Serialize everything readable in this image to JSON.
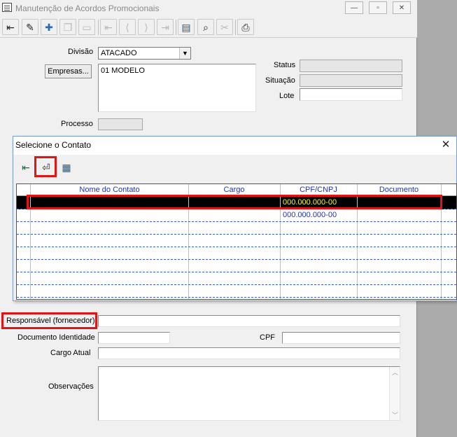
{
  "main_window": {
    "title": "Manutenção de Acordos Promocionais",
    "caption_buttons": [
      "—",
      "▫",
      "✕"
    ]
  },
  "toolbar": {
    "buttons": [
      {
        "name": "exit-icon",
        "glyph": "⇤"
      },
      {
        "name": "pencil-icon",
        "glyph": "✎"
      },
      {
        "name": "add-record-icon",
        "glyph": "✚"
      },
      {
        "name": "copy-record-icon",
        "glyph": "❐"
      },
      {
        "name": "remove-record-icon",
        "glyph": "▭"
      },
      {
        "name": "first-record-icon",
        "glyph": "⇤"
      },
      {
        "name": "prev-record-icon",
        "glyph": "⟨"
      },
      {
        "name": "next-record-icon",
        "glyph": "⟩"
      },
      {
        "name": "last-record-icon",
        "glyph": "⇥"
      },
      {
        "name": "list-icon",
        "glyph": "▤"
      },
      {
        "name": "binoculars-icon",
        "glyph": "⌕"
      },
      {
        "name": "tools-icon",
        "glyph": "✂"
      },
      {
        "name": "printer-icon",
        "glyph": "⎙"
      }
    ]
  },
  "form": {
    "divisao_label": "Divisão",
    "divisao_value": "ATACADO",
    "empresas_button": "Empresas...",
    "empresas_value": "01 MODELO",
    "status_label": "Status",
    "status_value": "",
    "situacao_label": "Situação",
    "situacao_value": "",
    "lote_label": "Lote",
    "lote_value": "",
    "processo_label": "Processo",
    "processo_value": "",
    "responsavel_label": "Responsável (fornecedor)",
    "responsavel_value": "",
    "documento_label": "Documento Identidade",
    "documento_value": "",
    "cpf_label": "CPF",
    "cpf_value": "",
    "cargo_label": "Cargo Atual",
    "cargo_value": "",
    "observacoes_label": "Observações",
    "observacoes_value": ""
  },
  "dialog": {
    "title": "Selecione o Contato",
    "close_glyph": "✕",
    "toolbar": [
      {
        "name": "exit-icon",
        "glyph": "⇤"
      },
      {
        "name": "select-contact-icon",
        "glyph": "⏎"
      },
      {
        "name": "new-grid-icon",
        "glyph": "▦"
      }
    ],
    "grid": {
      "columns": [
        "Nome do Contato",
        "Cargo",
        "CPF/CNPJ",
        "Documento"
      ],
      "rows": [
        {
          "nome": "",
          "cargo": "",
          "cpf": "000.000.000-00",
          "documento": "",
          "selected": true
        },
        {
          "nome": "",
          "cargo": "",
          "cpf": "000.000.000-00",
          "documento": "",
          "selected": false
        }
      ]
    }
  },
  "colors": {
    "highlight": "#e01414",
    "grid_text": "#1e32b4",
    "selected_text": "#ffff00"
  }
}
